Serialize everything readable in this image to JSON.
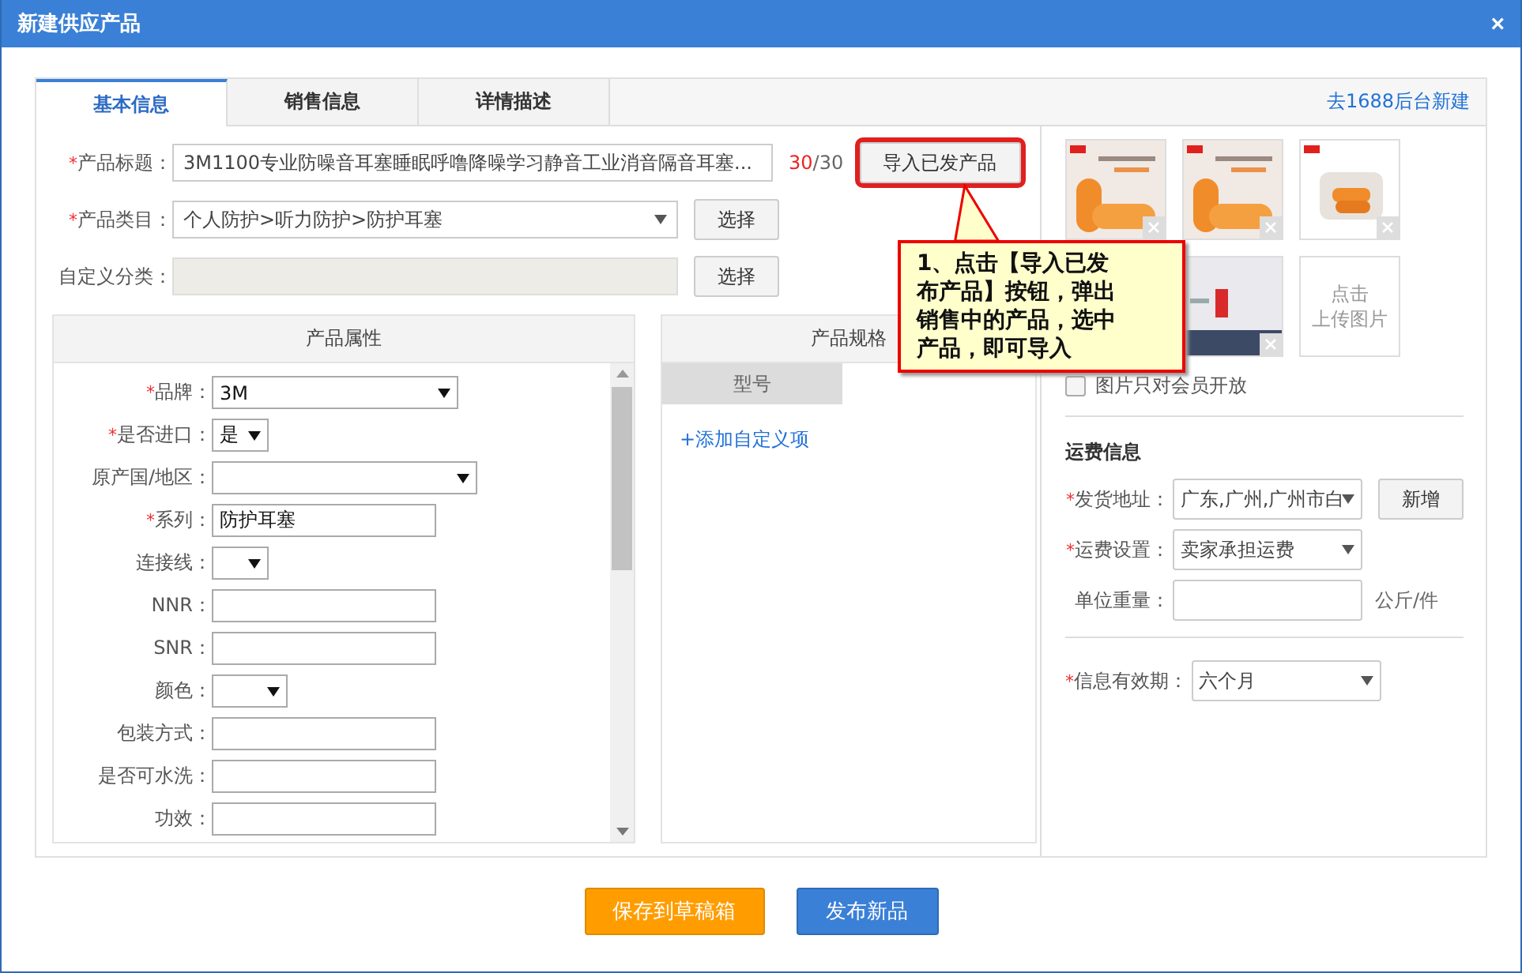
{
  "window": {
    "title": "新建供应产品",
    "close": "×"
  },
  "tabs": [
    {
      "label": "基本信息",
      "selected": true
    },
    {
      "label": "销售信息",
      "selected": false
    },
    {
      "label": "详情描述",
      "selected": false
    }
  ],
  "backend_link": "去1688后台新建",
  "fields": [
    {
      "kind": "text",
      "mark": "*",
      "label": "产品标题：",
      "value": "3M1100专业防噪音耳塞睡眠呼噜降噪学习静音工业消音隔音耳塞...",
      "count": "30",
      "limit": "/30",
      "button": "导入已发产品",
      "highlighted": true
    },
    {
      "kind": "select",
      "mark": "*",
      "label": "产品类目：",
      "value": "个人防护>听力防护>防护耳塞",
      "button": "选择"
    },
    {
      "kind": "text",
      "label": "自定义分类：",
      "button": "选择",
      "disabled": true
    }
  ],
  "attributes": {
    "title": "产品属性",
    "rows": [
      {
        "kind": "select",
        "mark": "*",
        "label": "品牌：",
        "value": "3M"
      },
      {
        "kind": "select",
        "mark": "*",
        "label": "是否进口：",
        "value": "是"
      },
      {
        "kind": "select",
        "label": "原产国/地区："
      },
      {
        "kind": "input",
        "mark": "*",
        "label": "系列：",
        "value": "防护耳塞"
      },
      {
        "kind": "select",
        "label": "连接线："
      },
      {
        "kind": "input",
        "label": "NNR："
      },
      {
        "kind": "input",
        "label": "SNR："
      },
      {
        "kind": "select",
        "label": "颜色："
      },
      {
        "kind": "input",
        "label": "包装方式："
      },
      {
        "kind": "input",
        "label": "是否可水洗："
      },
      {
        "kind": "input",
        "label": "功效："
      }
    ]
  },
  "specs": {
    "title": "产品规格",
    "tab": "型号",
    "add_link": "+添加自定义项"
  },
  "images": {
    "items": [
      {
        "kind": "picture"
      },
      {
        "kind": "picture"
      },
      {
        "kind": "picture"
      },
      {
        "kind": "picture"
      }
    ],
    "upload": [
      "点击",
      "上传图片"
    ],
    "members_only": {
      "label": "图片只对会员开放",
      "checked": false
    }
  },
  "shipping": {
    "heading": "运费信息",
    "rows": [
      {
        "kind": "select",
        "mark": "*",
        "label": "发货地址：",
        "value": "广东,广州,广州市白",
        "button": "新增"
      },
      {
        "kind": "select",
        "mark": "*",
        "label": "运费设置：",
        "value": "卖家承担运费"
      },
      {
        "kind": "input",
        "label": "单位重量：",
        "unit": "公斤/件"
      }
    ]
  },
  "validity": {
    "mark": "*",
    "label": "信息有效期：",
    "value": "六个月"
  },
  "callout": [
    "1、点击【导入已发",
    "布产品】按钮，弹出",
    "销售中的产品，选中",
    "产品，即可导入"
  ],
  "footer": [
    {
      "label": "保存到草稿箱",
      "kind": "secondary"
    },
    {
      "label": "发布新品",
      "kind": "primary"
    }
  ]
}
